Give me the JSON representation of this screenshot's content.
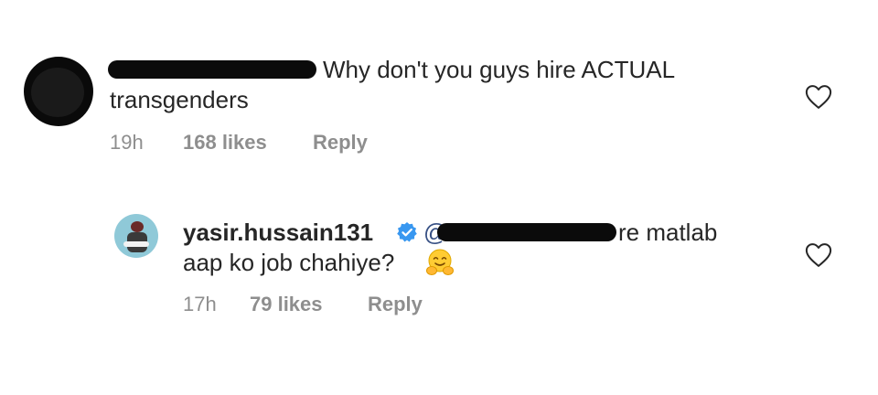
{
  "comment1": {
    "text_line1": "Why don't you guys hire ACTUAL",
    "text_line2": "transgenders",
    "time": "19h",
    "likes": "168 likes",
    "reply": "Reply"
  },
  "reply1": {
    "username": "yasir.hussain131",
    "mention_prefix": "@",
    "text_line1_suffix": "re matlab",
    "text_line2": "aap ko job chahiye?",
    "emoji": "🤗",
    "time": "17h",
    "likes": "79 likes",
    "reply": "Reply"
  },
  "colors": {
    "text": "#262626",
    "meta": "#8e8e8e",
    "verified": "#3897f0",
    "redaction": "#0b0b0b",
    "mention": "#385185"
  },
  "icons": [
    "heart-icon",
    "verified-badge-icon",
    "hug-emoji-icon"
  ]
}
